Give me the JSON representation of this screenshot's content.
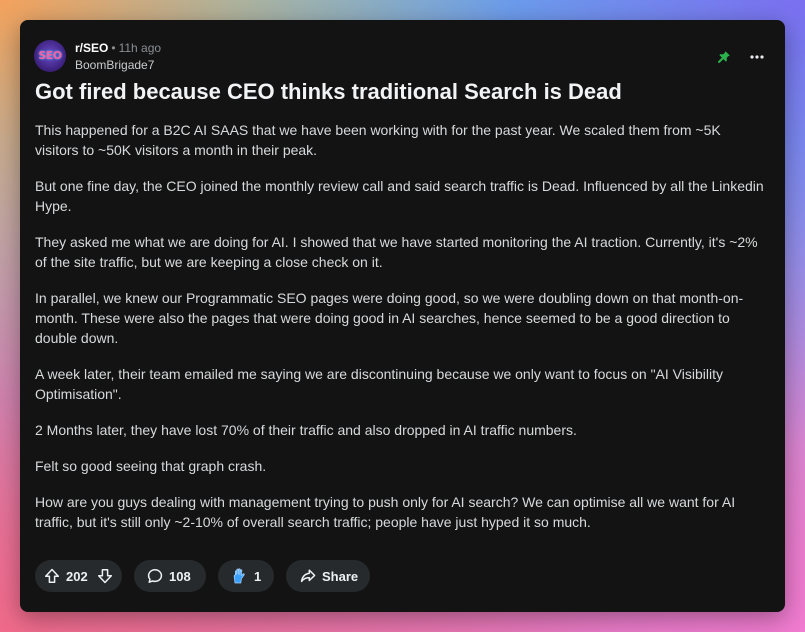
{
  "post": {
    "subreddit": "r/SEO",
    "separator": "•",
    "time_ago": "11h ago",
    "username": "BoomBrigade7",
    "avatar_text": "SEO",
    "title": "Got fired because CEO thinks traditional Search is Dead",
    "paragraphs": [
      "This happened for a B2C AI SAAS that we have been working with for the past year. We scaled them from ~5K visitors to ~50K visitors a month in their peak.",
      "But one fine day, the CEO joined the monthly review call and said search traffic is Dead. Influenced by all the Linkedin Hype.",
      "They asked me what we are doing for AI. I showed that we have started monitoring the AI traction. Currently, it's ~2% of the site traffic, but we are keeping a close check on it.",
      "In parallel, we knew our Programmatic SEO pages were doing good, so we were doubling down on that month-on-month. These were also the pages that were doing good in AI searches, hence seemed to be a good direction to double down.",
      "A week later, their team emailed me saying we are discontinuing because we only want to focus on \"AI Visibility Optimisation\".",
      "2 Months later, they have lost  70% of their traffic and also dropped in AI traffic numbers.",
      "Felt so good seeing that graph crash.",
      "How are you guys dealing with management trying to push only for AI search? We can optimise all we want for AI traffic, but it's still only ~2-10% of overall search traffic; people have just hyped it so much."
    ]
  },
  "actions": {
    "vote_count": "202",
    "comment_count": "108",
    "award_count": "1",
    "share_label": "Share"
  },
  "icons": {
    "pin": "pin-icon",
    "more": "more-options-icon",
    "upvote": "upvote-arrow-icon",
    "downvote": "downvote-arrow-icon",
    "comment": "comment-bubble-icon",
    "award": "award-hand-icon",
    "share": "share-arrow-icon"
  },
  "colors": {
    "card_bg": "#131313",
    "pill_bg": "#272a2c",
    "pin_green": "#2bb24c",
    "award_blue": "#3aa0ff"
  }
}
